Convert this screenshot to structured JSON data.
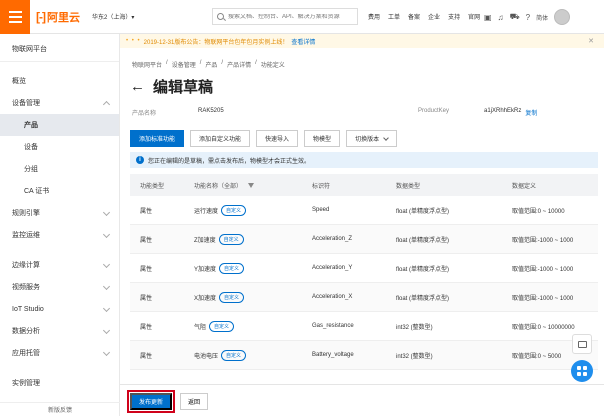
{
  "topbar": {
    "logo_mark": "[-]",
    "logo_text": "阿里云",
    "region": "华东2（上海）▾",
    "search_placeholder": "搜索文档、控制台、API、解决方案和资源",
    "links": [
      "费用",
      "工单",
      "备案",
      "企业",
      "支持",
      "官网"
    ],
    "lang": "简体",
    "icons": [
      "terminal-icon",
      "bell-icon",
      "cart-icon",
      "help-icon"
    ]
  },
  "sidebar": {
    "title": "物联网平台",
    "items": [
      {
        "label": "概览"
      },
      {
        "label": "设备管理"
      },
      {
        "label": "产品"
      },
      {
        "label": "设备"
      },
      {
        "label": "分组"
      },
      {
        "label": "CA 证书"
      },
      {
        "label": "规则引擎"
      },
      {
        "label": "监控运维"
      },
      {
        "label": "边缘计算"
      },
      {
        "label": "视频服务"
      },
      {
        "label": "IoT Studio"
      },
      {
        "label": "数据分析"
      },
      {
        "label": "应用托管"
      },
      {
        "label": "实例管理"
      }
    ],
    "footer": "新版反馈"
  },
  "notice": {
    "text": "2019-12-31版布公告：物联网平台包年包月实例上线！",
    "link": "查看详情"
  },
  "breadcrumb": [
    "物联网平台",
    "/",
    "设备管理",
    "/",
    "产品",
    "/",
    "产品详情",
    "/",
    "功能定义"
  ],
  "page": {
    "back": "←",
    "title": "编辑草稿",
    "product_name_label": "产品名称",
    "product_name": "RAK5205",
    "product_key_label": "ProductKey",
    "product_key": "a1jXRhhEkRz",
    "copy": "复制"
  },
  "toolbar": {
    "add_std": "添加标准功能",
    "add_custom": "添加自定义功能",
    "quick_import": "快速导入",
    "tsl": "物模型",
    "switch_version": "切换版本"
  },
  "info": {
    "icon": "i",
    "text": "您正在编辑的是草稿，需点击发布后，物模型才会正式生效。"
  },
  "table": {
    "headers": [
      "功能类型",
      "功能名称（全部）",
      "标识符",
      "数据类型",
      "数据定义"
    ],
    "rows": [
      [
        "属性",
        "运行速度",
        "自定义",
        "Speed",
        "float (单精度浮点型)",
        "取值范围:0 ~ 10000"
      ],
      [
        "属性",
        "Z加速度",
        "自定义",
        "Acceleration_Z",
        "float (单精度浮点型)",
        "取值范围:-1000 ~ 1000"
      ],
      [
        "属性",
        "Y加速度",
        "自定义",
        "Acceleration_Y",
        "float (单精度浮点型)",
        "取值范围:-1000 ~ 1000"
      ],
      [
        "属性",
        "X加速度",
        "自定义",
        "Acceleration_X",
        "float (单精度浮点型)",
        "取值范围:-1000 ~ 1000"
      ],
      [
        "属性",
        "气阻",
        "自定义",
        "Gas_resistance",
        "int32 (整数型)",
        "取值范围:0 ~ 10000000"
      ],
      [
        "属性",
        "电池电压",
        "自定义",
        "Battery_voltage",
        "int32 (整数型)",
        "取值范围:0 ~ 5000"
      ]
    ]
  },
  "footer": {
    "publish": "发布更新",
    "back": "返回"
  }
}
